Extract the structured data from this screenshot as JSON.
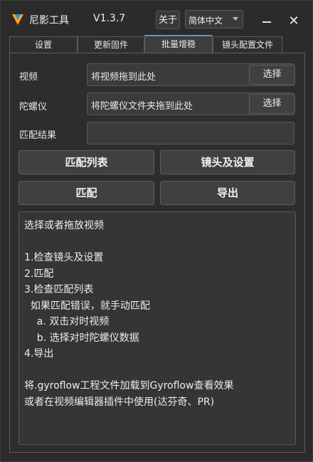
{
  "title_bar": {
    "app_name": "尼影工具",
    "version": "V1.3.7",
    "about_label": "关于",
    "language_selected": "简体中文",
    "close_glyph": "✕"
  },
  "tabs": [
    {
      "label": "设置"
    },
    {
      "label": "更新固件"
    },
    {
      "label": "批量增稳"
    },
    {
      "label": "镜头配置文件"
    }
  ],
  "form": {
    "video_label": "视频",
    "video_placeholder": "将视频拖到此处",
    "gyro_label": "陀螺仪",
    "gyro_placeholder": "将陀螺仪文件夹拖到此处",
    "match_result_label": "匹配结果",
    "match_result_value": "",
    "select_label": "选择"
  },
  "buttons": {
    "match_list": "匹配列表",
    "lens_settings": "镜头及设置",
    "match": "匹配",
    "export": "导出"
  },
  "instructions": [
    "选择或者拖放视频",
    "",
    "1.检查镜头及设置",
    "2.匹配",
    "3.检查匹配列表",
    "  如果匹配错误，就手动匹配",
    "    a. 双击对时视频",
    "    b. 选择对时陀螺仪数据",
    "4.导出",
    "",
    "将.gyroflow工程文件加载到Gyroflow查看效果",
    "或者在视频编辑器插件中使用(达芬奇、PR)"
  ],
  "colors": {
    "accent": "#3aa7c7",
    "logo_orange": "#f5a623",
    "logo_blue": "#2d8bd6"
  }
}
